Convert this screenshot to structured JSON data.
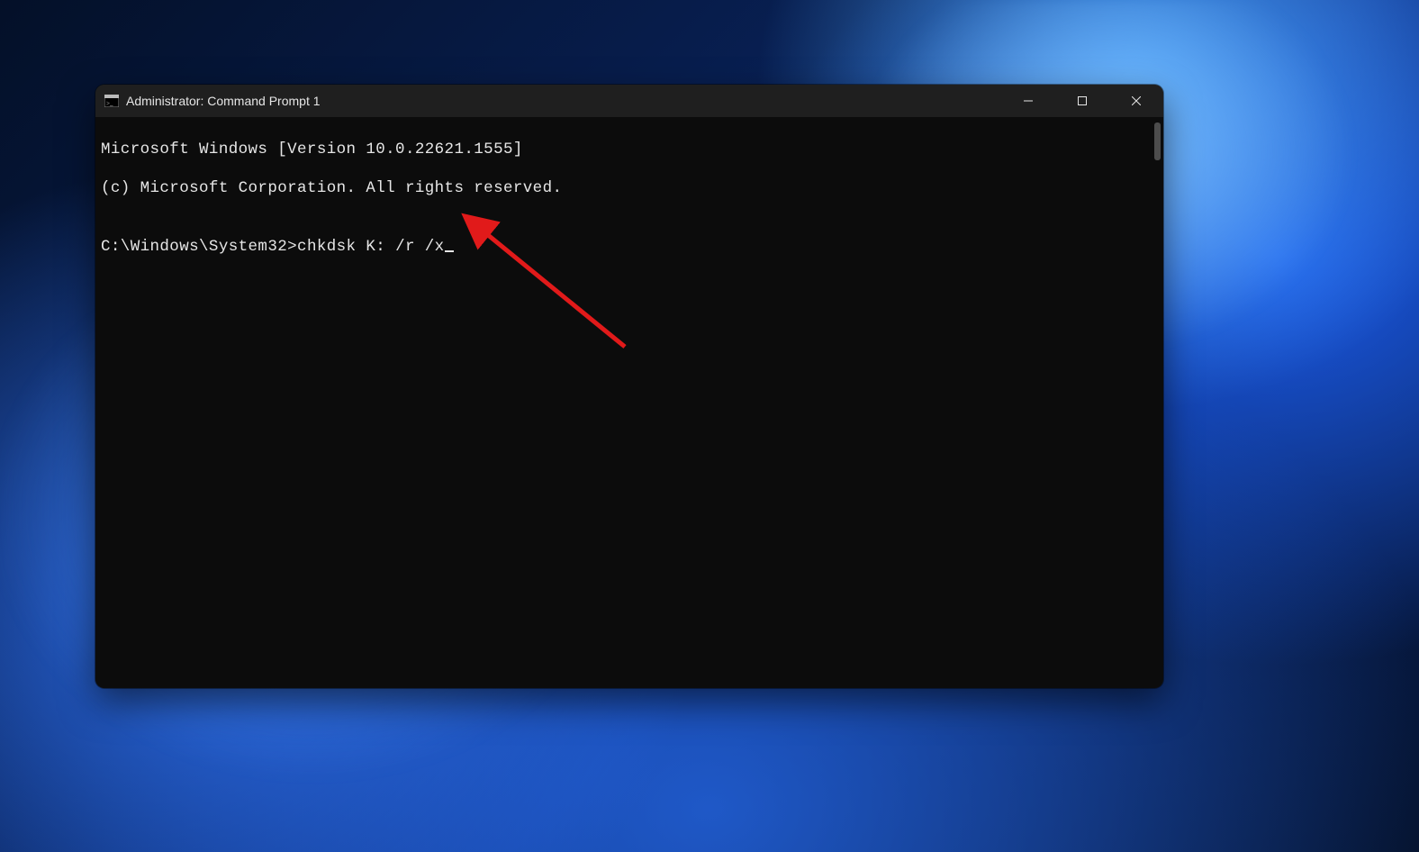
{
  "window": {
    "title": "Administrator: Command Prompt 1"
  },
  "terminal": {
    "line1": "Microsoft Windows [Version 10.0.22621.1555]",
    "line2": "(c) Microsoft Corporation. All rights reserved.",
    "blank": "",
    "prompt": "C:\\Windows\\System32>",
    "command": "chkdsk K: /r /x"
  },
  "annotation": {
    "color": "#e11a1a"
  }
}
